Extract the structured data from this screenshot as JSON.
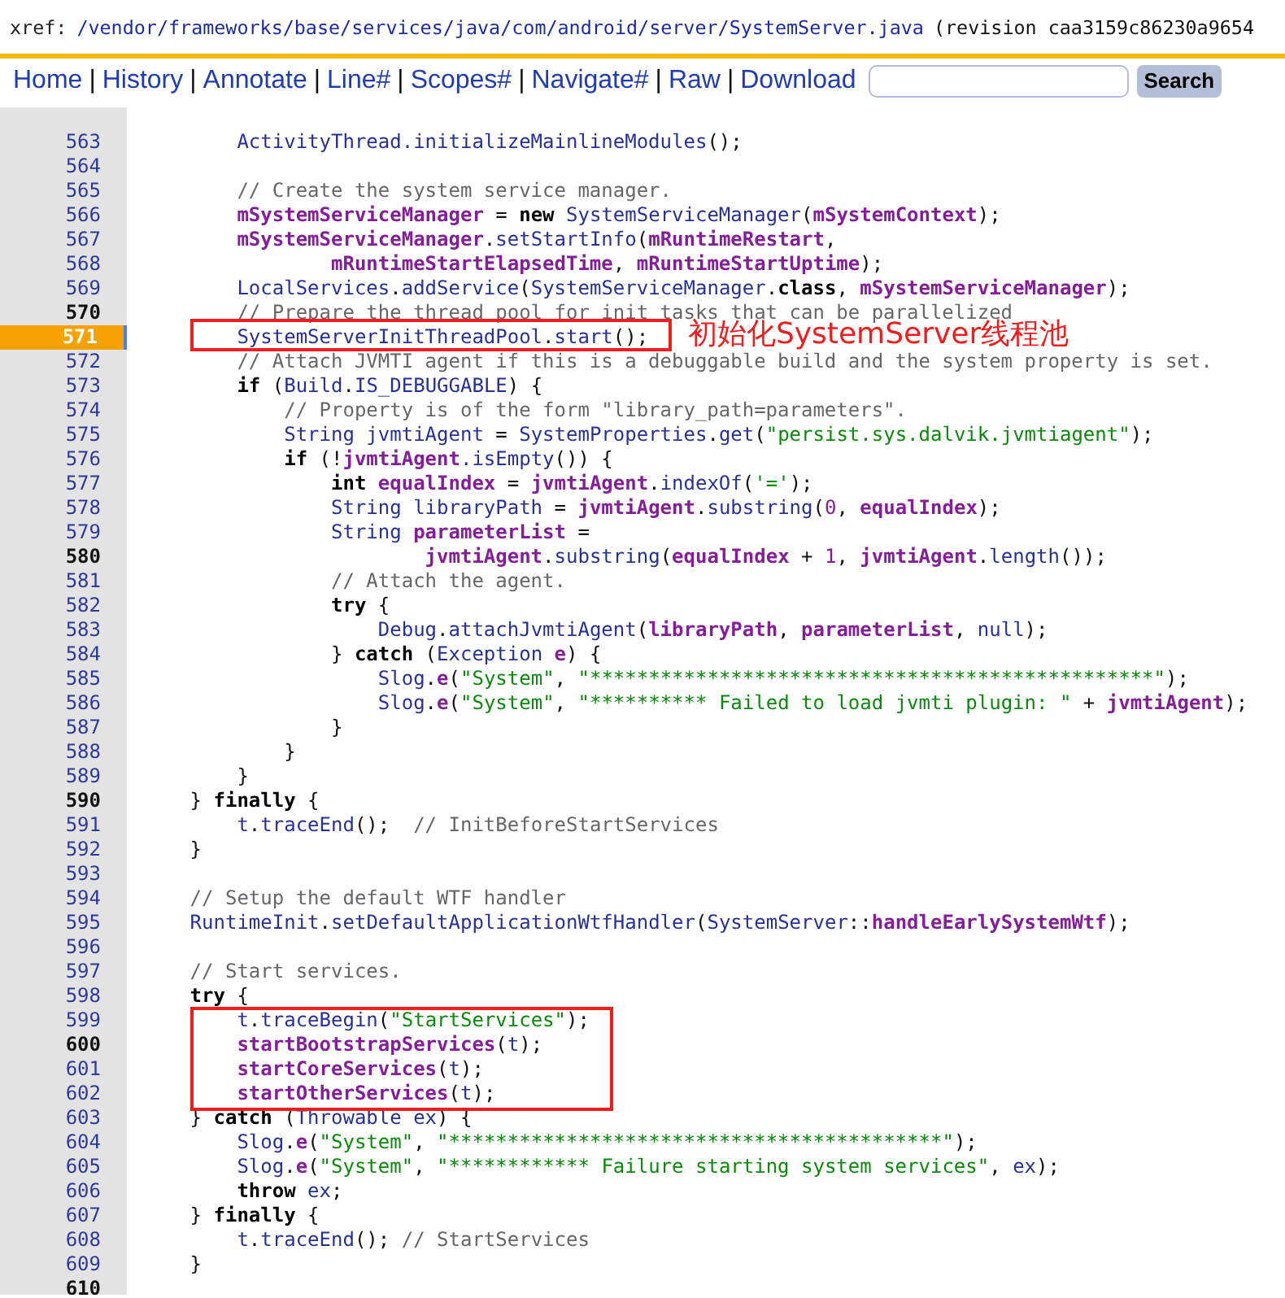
{
  "breadcrumb": {
    "prefix": "xref:",
    "path": [
      "/vendor",
      "/frameworks",
      "/base",
      "/services",
      "/java",
      "/com",
      "/android",
      "/server",
      "/SystemServer.java"
    ],
    "revision": "(revision caa3159c86230a9654"
  },
  "nav": {
    "links": [
      {
        "label": "Home",
        "separator": "|"
      },
      {
        "label": "History",
        "separator": "|"
      },
      {
        "label": "Annotate",
        "separator": "|"
      },
      {
        "label": "Line#",
        "separator": "|"
      },
      {
        "label": "Scopes#",
        "separator": "|"
      },
      {
        "label": "Navigate#",
        "separator": "|"
      },
      {
        "label": "Raw",
        "separator": "|"
      },
      {
        "label": "Download"
      }
    ],
    "search_button": "Search"
  },
  "code": {
    "lines": [
      {
        "number": "563",
        "bold": false,
        "selected": false,
        "boxed": false,
        "segments": [
          {
            "kind": "name",
            "text": "            ActivityThread.initializeMainlineModules"
          },
          {
            "kind": "plain",
            "text": "();"
          }
        ]
      },
      {
        "number": "564",
        "bold": false,
        "selected": false,
        "boxed": false
      },
      {
        "number": "565",
        "bold": false,
        "selected": false,
        "boxed": false,
        "segments": [
          {
            "kind": "comment",
            "text": "            // Create the system service manager."
          }
        ]
      },
      {
        "number": "566",
        "bold": false,
        "selected": false,
        "boxed": false,
        "segments": [
          {
            "kind": "field",
            "text": "            mSystemServiceManager"
          },
          {
            "kind": "plain",
            "text": " = "
          },
          {
            "kind": "keyword",
            "text": "new "
          },
          {
            "kind": "name",
            "text": "SystemServiceManager"
          },
          {
            "kind": "plain",
            "text": "("
          },
          {
            "kind": "field",
            "text": "mSystemContext"
          },
          {
            "kind": "plain",
            "text": ");"
          }
        ]
      },
      {
        "number": "567",
        "bold": false,
        "selected": false,
        "boxed": false,
        "segments": [
          {
            "kind": "field",
            "text": "            mSystemServiceManager"
          },
          {
            "kind": "plain",
            "text": "."
          },
          {
            "kind": "name",
            "text": "setStartInfo"
          },
          {
            "kind": "plain",
            "text": "("
          },
          {
            "kind": "field",
            "text": "mRuntimeRestart"
          },
          {
            "kind": "plain",
            "text": ","
          }
        ]
      },
      {
        "number": "568",
        "bold": false,
        "selected": false,
        "boxed": false,
        "segments": [
          {
            "kind": "field",
            "text": "                    mRuntimeStartElapsedTime"
          },
          {
            "kind": "plain",
            "text": ", "
          },
          {
            "kind": "field",
            "text": "mRuntimeStartUptime"
          },
          {
            "kind": "plain",
            "text": ");"
          }
        ]
      },
      {
        "number": "569",
        "bold": false,
        "selected": false,
        "boxed": false,
        "segments": [
          {
            "kind": "name",
            "text": "            LocalServices"
          },
          {
            "kind": "plain",
            "text": "."
          },
          {
            "kind": "name",
            "text": "addService"
          },
          {
            "kind": "plain",
            "text": "("
          },
          {
            "kind": "name",
            "text": "SystemServiceManager"
          },
          {
            "kind": "plain",
            "text": "."
          },
          {
            "kind": "keyword",
            "text": "class"
          },
          {
            "kind": "plain",
            "text": ", "
          },
          {
            "kind": "field",
            "text": "mSystemServiceManager"
          },
          {
            "kind": "plain",
            "text": ");"
          }
        ]
      },
      {
        "number": "570",
        "bold": true,
        "selected": false,
        "boxed": false,
        "segments": [
          {
            "kind": "comment",
            "text": "            // Prepare the thread pool for init tasks that can be parallelized"
          }
        ]
      },
      {
        "number": "571",
        "bold": true,
        "selected": true,
        "boxed": true,
        "callout": "初始化SystemServer线程池",
        "segments": [
          {
            "kind": "name",
            "text": "            SystemServerInitThreadPool"
          },
          {
            "kind": "plain",
            "text": "."
          },
          {
            "kind": "name",
            "text": "start"
          },
          {
            "kind": "plain",
            "text": "();"
          }
        ]
      },
      {
        "number": "572",
        "bold": false,
        "selected": false,
        "boxed": false,
        "segments": [
          {
            "kind": "comment",
            "text": "            // Attach JVMTI agent if this is a debuggable build and the system property is set."
          }
        ]
      },
      {
        "number": "573",
        "bold": false,
        "selected": false,
        "boxed": false,
        "segments": [
          {
            "kind": "keyword",
            "text": "            if"
          },
          {
            "kind": "plain",
            "text": " ("
          },
          {
            "kind": "name",
            "text": "Build"
          },
          {
            "kind": "plain",
            "text": "."
          },
          {
            "kind": "name",
            "text": "IS_DEBUGGABLE"
          },
          {
            "kind": "plain",
            "text": ") {"
          }
        ]
      },
      {
        "number": "574",
        "bold": false,
        "selected": false,
        "boxed": false,
        "segments": [
          {
            "kind": "comment",
            "text": "                // Property is of the form \"library_path=parameters\"."
          }
        ]
      },
      {
        "number": "575",
        "bold": false,
        "selected": false,
        "boxed": false,
        "segments": [
          {
            "kind": "name",
            "text": "                String jvmtiAgent"
          },
          {
            "kind": "plain",
            "text": " = "
          },
          {
            "kind": "name",
            "text": "SystemProperties"
          },
          {
            "kind": "plain",
            "text": "."
          },
          {
            "kind": "name",
            "text": "get"
          },
          {
            "kind": "plain",
            "text": "("
          },
          {
            "kind": "string",
            "text": "\"persist.sys.dalvik.jvmtiagent\""
          },
          {
            "kind": "plain",
            "text": ");"
          }
        ]
      },
      {
        "number": "576",
        "bold": false,
        "selected": false,
        "boxed": false,
        "segments": [
          {
            "kind": "keyword",
            "text": "                if"
          },
          {
            "kind": "plain",
            "text": " (!"
          },
          {
            "kind": "field",
            "text": "jvmtiAgent"
          },
          {
            "kind": "name",
            "text": ".isEmpty"
          },
          {
            "kind": "plain",
            "text": "()) {"
          }
        ]
      },
      {
        "number": "577",
        "bold": false,
        "selected": false,
        "boxed": false,
        "segments": [
          {
            "kind": "keyword",
            "text": "                    int "
          },
          {
            "kind": "field",
            "text": "equalIndex"
          },
          {
            "kind": "plain",
            "text": " = "
          },
          {
            "kind": "field",
            "text": "jvmtiAgent"
          },
          {
            "kind": "plain",
            "text": "."
          },
          {
            "kind": "name",
            "text": "indexOf"
          },
          {
            "kind": "plain",
            "text": "("
          },
          {
            "kind": "string",
            "text": "'='"
          },
          {
            "kind": "plain",
            "text": ");"
          }
        ]
      },
      {
        "number": "578",
        "bold": false,
        "selected": false,
        "boxed": false,
        "segments": [
          {
            "kind": "name",
            "text": "                    String libraryPath"
          },
          {
            "kind": "plain",
            "text": " = "
          },
          {
            "kind": "field",
            "text": "jvmtiAgent"
          },
          {
            "kind": "plain",
            "text": "."
          },
          {
            "kind": "name",
            "text": "substring"
          },
          {
            "kind": "plain",
            "text": "("
          },
          {
            "kind": "number",
            "text": "0"
          },
          {
            "kind": "plain",
            "text": ", "
          },
          {
            "kind": "field",
            "text": "equalIndex"
          },
          {
            "kind": "plain",
            "text": ");"
          }
        ]
      },
      {
        "number": "579",
        "bold": false,
        "selected": false,
        "boxed": false,
        "segments": [
          {
            "kind": "name",
            "text": "                    String "
          },
          {
            "kind": "field",
            "text": "parameterList"
          },
          {
            "kind": "plain",
            "text": " ="
          }
        ]
      },
      {
        "number": "580",
        "bold": true,
        "selected": false,
        "boxed": false,
        "segments": [
          {
            "kind": "field",
            "text": "                            jvmtiAgent"
          },
          {
            "kind": "plain",
            "text": "."
          },
          {
            "kind": "name",
            "text": "substring"
          },
          {
            "kind": "plain",
            "text": "("
          },
          {
            "kind": "field",
            "text": "equalIndex"
          },
          {
            "kind": "plain",
            "text": " + "
          },
          {
            "kind": "number",
            "text": "1"
          },
          {
            "kind": "plain",
            "text": ", "
          },
          {
            "kind": "field",
            "text": "jvmtiAgent"
          },
          {
            "kind": "plain",
            "text": "."
          },
          {
            "kind": "name",
            "text": "length"
          },
          {
            "kind": "plain",
            "text": "());"
          }
        ]
      },
      {
        "number": "581",
        "bold": false,
        "selected": false,
        "boxed": false,
        "segments": [
          {
            "kind": "comment",
            "text": "                    // Attach the agent."
          }
        ]
      },
      {
        "number": "582",
        "bold": false,
        "selected": false,
        "boxed": false,
        "segments": [
          {
            "kind": "keyword",
            "text": "                    try"
          },
          {
            "kind": "plain",
            "text": " {"
          }
        ]
      },
      {
        "number": "583",
        "bold": false,
        "selected": false,
        "boxed": false,
        "segments": [
          {
            "kind": "name",
            "text": "                        Debug"
          },
          {
            "kind": "plain",
            "text": "."
          },
          {
            "kind": "name",
            "text": "attachJvmtiAgent"
          },
          {
            "kind": "plain",
            "text": "("
          },
          {
            "kind": "field",
            "text": "libraryPath"
          },
          {
            "kind": "plain",
            "text": ", "
          },
          {
            "kind": "field",
            "text": "parameterList"
          },
          {
            "kind": "plain",
            "text": ", "
          },
          {
            "kind": "name",
            "text": "null"
          },
          {
            "kind": "plain",
            "text": ");"
          }
        ]
      },
      {
        "number": "584",
        "bold": false,
        "selected": false,
        "boxed": false,
        "segments": [
          {
            "kind": "plain",
            "text": "                    } "
          },
          {
            "kind": "keyword",
            "text": "catch"
          },
          {
            "kind": "plain",
            "text": " ("
          },
          {
            "kind": "name",
            "text": "Exception "
          },
          {
            "kind": "field",
            "text": "e"
          },
          {
            "kind": "plain",
            "text": ") {"
          }
        ]
      },
      {
        "number": "585",
        "bold": false,
        "selected": false,
        "boxed": false,
        "segments": [
          {
            "kind": "name",
            "text": "                        Slog"
          },
          {
            "kind": "plain",
            "text": "."
          },
          {
            "kind": "field",
            "text": "e"
          },
          {
            "kind": "plain",
            "text": "("
          },
          {
            "kind": "string",
            "text": "\"System\""
          },
          {
            "kind": "plain",
            "text": ", "
          },
          {
            "kind": "string",
            "text": "\"************************************************\""
          },
          {
            "kind": "plain",
            "text": ");"
          }
        ]
      },
      {
        "number": "586",
        "bold": false,
        "selected": false,
        "boxed": false,
        "segments": [
          {
            "kind": "name",
            "text": "                        Slog"
          },
          {
            "kind": "plain",
            "text": "."
          },
          {
            "kind": "field",
            "text": "e"
          },
          {
            "kind": "plain",
            "text": "("
          },
          {
            "kind": "string",
            "text": "\"System\""
          },
          {
            "kind": "plain",
            "text": ", "
          },
          {
            "kind": "string",
            "text": "\"********** Failed to load jvmti plugin: \""
          },
          {
            "kind": "plain",
            "text": " + "
          },
          {
            "kind": "field",
            "text": "jvmtiAgent"
          },
          {
            "kind": "plain",
            "text": ");"
          }
        ]
      },
      {
        "number": "587",
        "bold": false,
        "selected": false,
        "boxed": false,
        "segments": [
          {
            "kind": "plain",
            "text": "                    }"
          }
        ]
      },
      {
        "number": "588",
        "bold": false,
        "selected": false,
        "boxed": false,
        "segments": [
          {
            "kind": "plain",
            "text": "                }"
          }
        ]
      },
      {
        "number": "589",
        "bold": false,
        "selected": false,
        "boxed": false,
        "segments": [
          {
            "kind": "plain",
            "text": "            }"
          }
        ]
      },
      {
        "number": "590",
        "bold": true,
        "selected": false,
        "boxed": false,
        "segments": [
          {
            "kind": "plain",
            "text": "        } "
          },
          {
            "kind": "keyword",
            "text": "finally"
          },
          {
            "kind": "plain",
            "text": " {"
          }
        ]
      },
      {
        "number": "591",
        "bold": false,
        "selected": false,
        "boxed": false,
        "segments": [
          {
            "kind": "name",
            "text": "            t"
          },
          {
            "kind": "plain",
            "text": "."
          },
          {
            "kind": "name",
            "text": "traceEnd"
          },
          {
            "kind": "plain",
            "text": "();  "
          },
          {
            "kind": "comment",
            "text": "// InitBeforeStartServices"
          }
        ]
      },
      {
        "number": "592",
        "bold": false,
        "selected": false,
        "boxed": false,
        "segments": [
          {
            "kind": "plain",
            "text": "        }"
          }
        ]
      },
      {
        "number": "593",
        "bold": false,
        "selected": false,
        "boxed": false
      },
      {
        "number": "594",
        "bold": false,
        "selected": false,
        "boxed": false,
        "segments": [
          {
            "kind": "comment",
            "text": "        // Setup the default WTF handler"
          }
        ]
      },
      {
        "number": "595",
        "bold": false,
        "selected": false,
        "boxed": false,
        "segments": [
          {
            "kind": "name",
            "text": "        RuntimeInit"
          },
          {
            "kind": "plain",
            "text": "."
          },
          {
            "kind": "name",
            "text": "setDefaultApplicationWtfHandler"
          },
          {
            "kind": "plain",
            "text": "("
          },
          {
            "kind": "name",
            "text": "SystemServer"
          },
          {
            "kind": "plain",
            "text": "::"
          },
          {
            "kind": "field",
            "text": "handleEarlySystemWtf"
          },
          {
            "kind": "plain",
            "text": ");"
          }
        ]
      },
      {
        "number": "596",
        "bold": false,
        "selected": false,
        "boxed": false
      },
      {
        "number": "597",
        "bold": false,
        "selected": false,
        "boxed": false,
        "segments": [
          {
            "kind": "comment",
            "text": "        // Start services."
          }
        ]
      },
      {
        "number": "598",
        "bold": false,
        "selected": false,
        "boxed": false,
        "segments": [
          {
            "kind": "keyword",
            "text": "        try"
          },
          {
            "kind": "plain",
            "text": " {"
          }
        ]
      },
      {
        "number": "599",
        "bold": false,
        "selected": false,
        "boxed": true,
        "segments": [
          {
            "kind": "name",
            "text": "            t"
          },
          {
            "kind": "plain",
            "text": "."
          },
          {
            "kind": "name",
            "text": "traceBegin"
          },
          {
            "kind": "plain",
            "text": "("
          },
          {
            "kind": "string",
            "text": "\"StartServices\""
          },
          {
            "kind": "plain",
            "text": ");"
          }
        ]
      },
      {
        "number": "600",
        "bold": true,
        "selected": false,
        "boxed": true,
        "segments": [
          {
            "kind": "field",
            "text": "            startBootstrapServices"
          },
          {
            "kind": "plain",
            "text": "("
          },
          {
            "kind": "name",
            "text": "t"
          },
          {
            "kind": "plain",
            "text": ");"
          }
        ]
      },
      {
        "number": "601",
        "bold": false,
        "selected": false,
        "boxed": true,
        "segments": [
          {
            "kind": "field",
            "text": "            startCoreServices"
          },
          {
            "kind": "plain",
            "text": "("
          },
          {
            "kind": "name",
            "text": "t"
          },
          {
            "kind": "plain",
            "text": ");"
          }
        ]
      },
      {
        "number": "602",
        "bold": false,
        "selected": false,
        "boxed": true,
        "segments": [
          {
            "kind": "field",
            "text": "            startOtherServices"
          },
          {
            "kind": "plain",
            "text": "("
          },
          {
            "kind": "name",
            "text": "t"
          },
          {
            "kind": "plain",
            "text": ");"
          }
        ]
      },
      {
        "number": "603",
        "bold": false,
        "selected": false,
        "boxed": false,
        "segments": [
          {
            "kind": "plain",
            "text": "        } "
          },
          {
            "kind": "keyword",
            "text": "catch"
          },
          {
            "kind": "plain",
            "text": " ("
          },
          {
            "kind": "name",
            "text": "Throwable ex"
          },
          {
            "kind": "plain",
            "text": ") {"
          }
        ]
      },
      {
        "number": "604",
        "bold": false,
        "selected": false,
        "boxed": false,
        "segments": [
          {
            "kind": "name",
            "text": "            Slog"
          },
          {
            "kind": "plain",
            "text": "."
          },
          {
            "kind": "field",
            "text": "e"
          },
          {
            "kind": "plain",
            "text": "("
          },
          {
            "kind": "string",
            "text": "\"System\""
          },
          {
            "kind": "plain",
            "text": ", "
          },
          {
            "kind": "string",
            "text": "\"******************************************\""
          },
          {
            "kind": "plain",
            "text": ");"
          }
        ]
      },
      {
        "number": "605",
        "bold": false,
        "selected": false,
        "boxed": false,
        "segments": [
          {
            "kind": "name",
            "text": "            Slog"
          },
          {
            "kind": "plain",
            "text": "."
          },
          {
            "kind": "field",
            "text": "e"
          },
          {
            "kind": "plain",
            "text": "("
          },
          {
            "kind": "string",
            "text": "\"System\""
          },
          {
            "kind": "plain",
            "text": ", "
          },
          {
            "kind": "string",
            "text": "\"************ Failure starting system services\""
          },
          {
            "kind": "plain",
            "text": ", "
          },
          {
            "kind": "name",
            "text": "ex"
          },
          {
            "kind": "plain",
            "text": ");"
          }
        ]
      },
      {
        "number": "606",
        "bold": false,
        "selected": false,
        "boxed": false,
        "segments": [
          {
            "kind": "keyword",
            "text": "            throw "
          },
          {
            "kind": "name",
            "text": "ex"
          },
          {
            "kind": "plain",
            "text": ";"
          }
        ]
      },
      {
        "number": "607",
        "bold": false,
        "selected": false,
        "boxed": false,
        "segments": [
          {
            "kind": "plain",
            "text": "        } "
          },
          {
            "kind": "keyword",
            "text": "finally"
          },
          {
            "kind": "plain",
            "text": " {"
          }
        ]
      },
      {
        "number": "608",
        "bold": false,
        "selected": false,
        "boxed": false,
        "segments": [
          {
            "kind": "name",
            "text": "            t"
          },
          {
            "kind": "plain",
            "text": "."
          },
          {
            "kind": "name",
            "text": "traceEnd"
          },
          {
            "kind": "plain",
            "text": "(); "
          },
          {
            "kind": "comment",
            "text": "// StartServices"
          }
        ]
      },
      {
        "number": "609",
        "bold": false,
        "selected": false,
        "boxed": false,
        "segments": [
          {
            "kind": "plain",
            "text": "        }"
          }
        ]
      },
      {
        "number": "610",
        "bold": true,
        "selected": false,
        "boxed": false
      }
    ]
  }
}
